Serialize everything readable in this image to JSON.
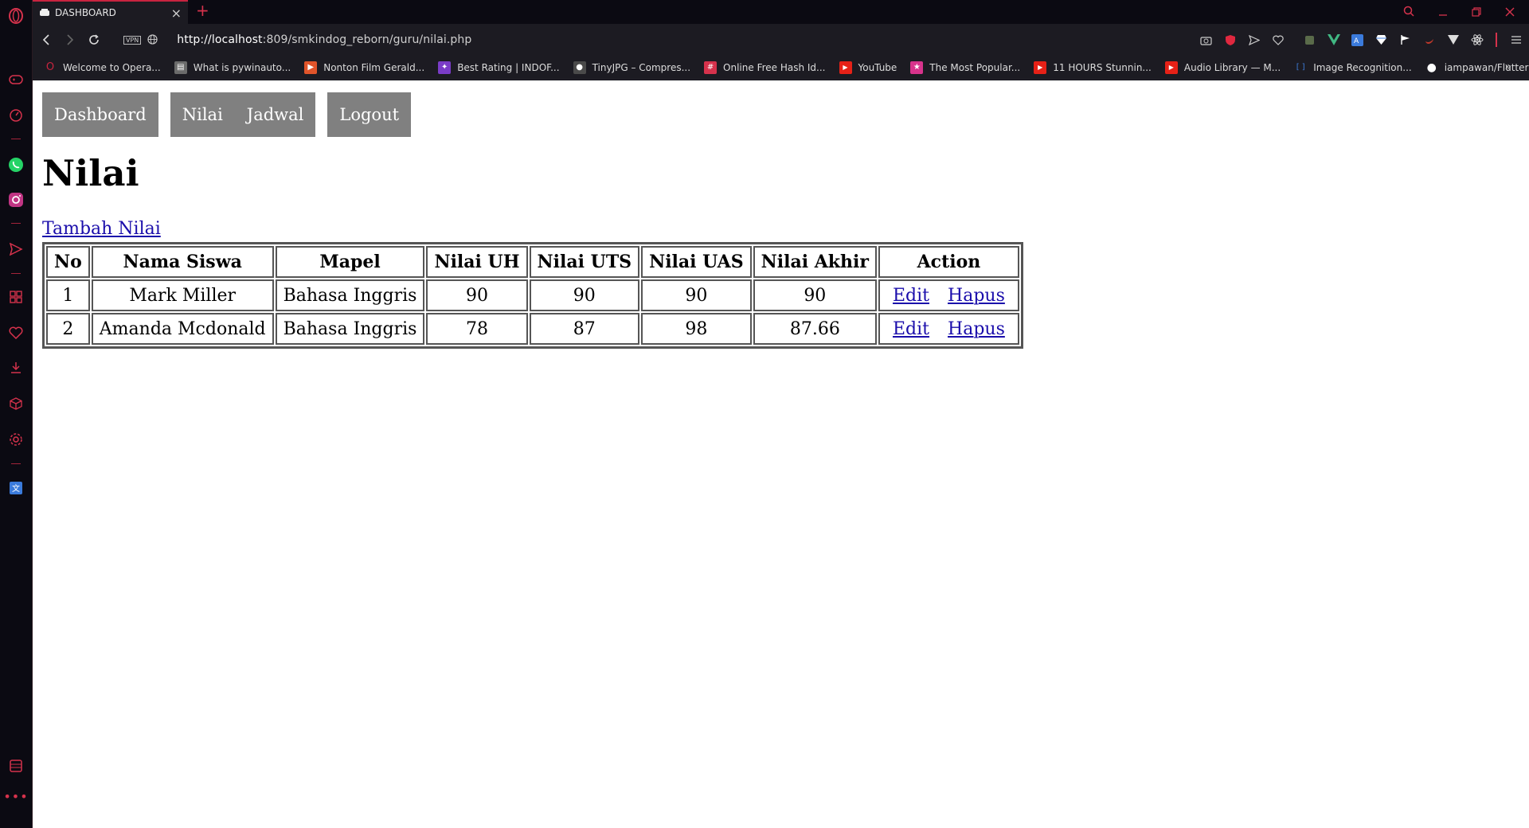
{
  "browser": {
    "tab_title": "DASHBOARD",
    "url_host": "http://localhost",
    "url_rest": ":809/smkindog_reborn/guru/nilai.php",
    "vpn_label": "VPN",
    "accent_color": "#d6324c",
    "bookmarks": [
      {
        "label": "Welcome to Opera...",
        "icon": "opera-icon",
        "color": "#c8243f"
      },
      {
        "label": "What is pywinauto...",
        "icon": "doc-icon",
        "color": "#6b6b6b"
      },
      {
        "label": "Nonton Film Gerald...",
        "icon": "film-icon",
        "color": "#e0542a"
      },
      {
        "label": "Best Rating | INDOF...",
        "icon": "bird-icon",
        "color": "#7a3cc7"
      },
      {
        "label": "TinyJPG – Compres...",
        "icon": "panda-icon",
        "color": "#4a4a4a"
      },
      {
        "label": "Online Free Hash Id...",
        "icon": "hash-icon",
        "color": "#d6324c"
      },
      {
        "label": "YouTube",
        "icon": "youtube-icon",
        "color": "#e62117"
      },
      {
        "label": "The Most Popular...",
        "icon": "star-icon",
        "color": "#d8338c"
      },
      {
        "label": "11 HOURS Stunnin...",
        "icon": "youtube-icon",
        "color": "#e62117"
      },
      {
        "label": "Audio Library — M...",
        "icon": "youtube-icon",
        "color": "#e62117"
      },
      {
        "label": "Image Recognition...",
        "icon": "bracket-icon",
        "color": "#3d7bd6"
      },
      {
        "label": "iampawan/FlutterEx...",
        "icon": "github-icon",
        "color": "#ffffff"
      }
    ]
  },
  "page": {
    "nav": {
      "dashboard": "Dashboard",
      "nilai": "Nilai",
      "jadwal": "Jadwal",
      "logout": "Logout"
    },
    "title": "Nilai",
    "add_link": "Tambah Nilai",
    "table": {
      "headers": [
        "No",
        "Nama Siswa",
        "Mapel",
        "Nilai UH",
        "Nilai UTS",
        "Nilai UAS",
        "Nilai Akhir",
        "Action"
      ],
      "rows": [
        {
          "no": "1",
          "nama": "Mark Miller",
          "mapel": "Bahasa Inggris",
          "uh": "90",
          "uts": "90",
          "uas": "90",
          "akhir": "90",
          "edit": "Edit",
          "hapus": "Hapus"
        },
        {
          "no": "2",
          "nama": "Amanda Mcdonald",
          "mapel": "Bahasa Inggris",
          "uh": "78",
          "uts": "87",
          "uas": "98",
          "akhir": "87.66",
          "edit": "Edit",
          "hapus": "Hapus"
        }
      ]
    }
  }
}
